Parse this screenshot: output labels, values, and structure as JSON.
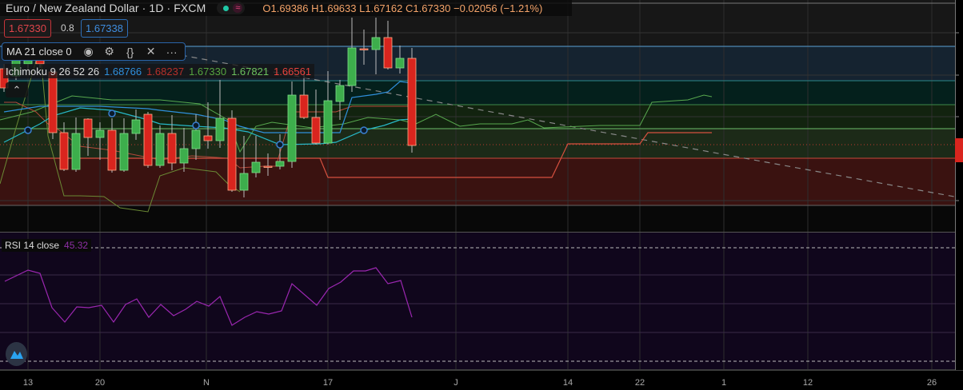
{
  "header": {
    "symbol": "Euro / New Zealand Dollar · 1D · FXCM",
    "market_status_icon": "market-open-dot-icon",
    "ohlc": {
      "open": "O1.69386",
      "high": "H1.69633",
      "low": "L1.67162",
      "close": "C1.67330",
      "change": "−0.02056 (−1.21%)"
    }
  },
  "trade": {
    "sell_price": "1.67330",
    "spread": "0.8",
    "buy_price": "1.67338"
  },
  "ma_legend": {
    "label": "MA 21 close 0",
    "icons": [
      "eye-icon",
      "gear-icon",
      "braces-icon",
      "close-icon",
      "more-icon"
    ]
  },
  "ichimoku": {
    "label": "Ichimoku 9 26 52 26",
    "values": [
      "1.68766",
      "1.68237",
      "1.67330",
      "1.67821",
      "1.66561"
    ]
  },
  "rsi": {
    "label": "RSI 14 close",
    "value": "45.32"
  },
  "time_axis": [
    "13",
    "20",
    "N",
    "17",
    "J",
    "14",
    "22",
    "1",
    "12",
    "26"
  ],
  "colors": {
    "up": "#3dae4c",
    "down": "#d9251e",
    "tenkan": "#2f8fdc",
    "kijun": "#b5483a",
    "rsi": "#9b27b0",
    "bg_rsi": "#10061c"
  }
}
